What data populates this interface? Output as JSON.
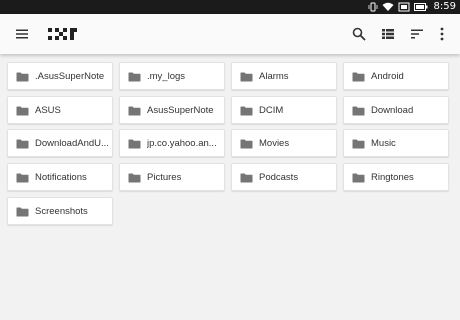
{
  "status_bar": {
    "time": "8:59",
    "icons": [
      "vibrate-icon",
      "wifi-icon",
      "cast-icon",
      "battery-icon"
    ]
  },
  "toolbar": {
    "menu_icon": "hamburger-menu-icon",
    "logo": "app-logo",
    "actions": [
      "search-icon",
      "list-view-icon",
      "sort-icon",
      "more-vert-icon"
    ]
  },
  "folders": [
    {
      "name": ".AsusSuperNote"
    },
    {
      "name": ".my_logs"
    },
    {
      "name": "Alarms"
    },
    {
      "name": "Android"
    },
    {
      "name": "ASUS"
    },
    {
      "name": "AsusSuperNote"
    },
    {
      "name": "DCIM"
    },
    {
      "name": "Download"
    },
    {
      "name": "DownloadAndU..."
    },
    {
      "name": "jp.co.yahoo.an..."
    },
    {
      "name": "Movies"
    },
    {
      "name": "Music"
    },
    {
      "name": "Notifications"
    },
    {
      "name": "Pictures"
    },
    {
      "name": "Podcasts"
    },
    {
      "name": "Ringtones"
    },
    {
      "name": "Screenshots"
    }
  ],
  "colors": {
    "status_bar": "#1b1b1b",
    "app_bar": "#fafafa",
    "background": "#f2f2f2",
    "folder_icon": "#757575"
  }
}
